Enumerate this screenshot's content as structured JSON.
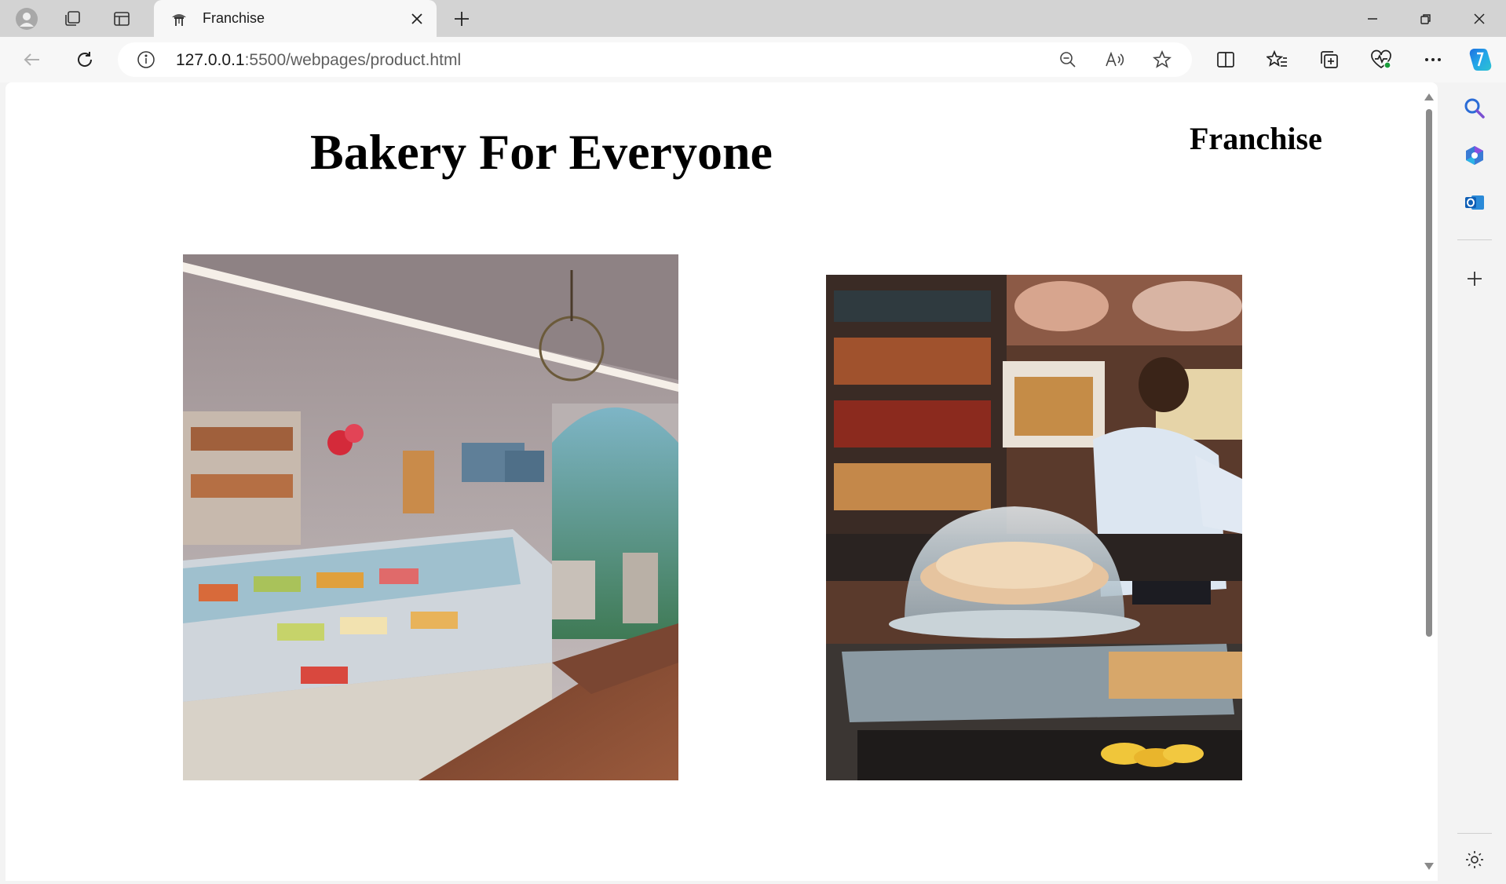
{
  "browser": {
    "tab": {
      "title": "Franchise",
      "favicon": "bakery-favicon-icon"
    },
    "address": {
      "host": "127.0.0.1",
      "rest": ":5500/webpages/product.html"
    },
    "toolbar_icons": [
      "back-icon",
      "refresh-icon",
      "site-info-icon",
      "zoom-out-icon",
      "read-aloud-icon",
      "favorite-star-icon",
      "split-screen-icon",
      "favorites-icon",
      "collections-icon",
      "browser-essentials-icon",
      "more-icon",
      "copilot-icon"
    ],
    "sidebar_icons": [
      "search-icon",
      "microsoft365-icon",
      "outlook-icon",
      "add-icon",
      "settings-icon"
    ],
    "colors": {
      "tabstrip": "#d3d3d3",
      "toolbar": "#f7f7f7",
      "page": "#ffffff"
    }
  },
  "page": {
    "heading": "Bakery For Everyone",
    "nav_link": "Franchise",
    "images": [
      {
        "name": "bakery-interior-photo",
        "description": "pastry shop interior"
      },
      {
        "name": "bakery-counter-photo",
        "description": "baker at counter"
      }
    ]
  }
}
